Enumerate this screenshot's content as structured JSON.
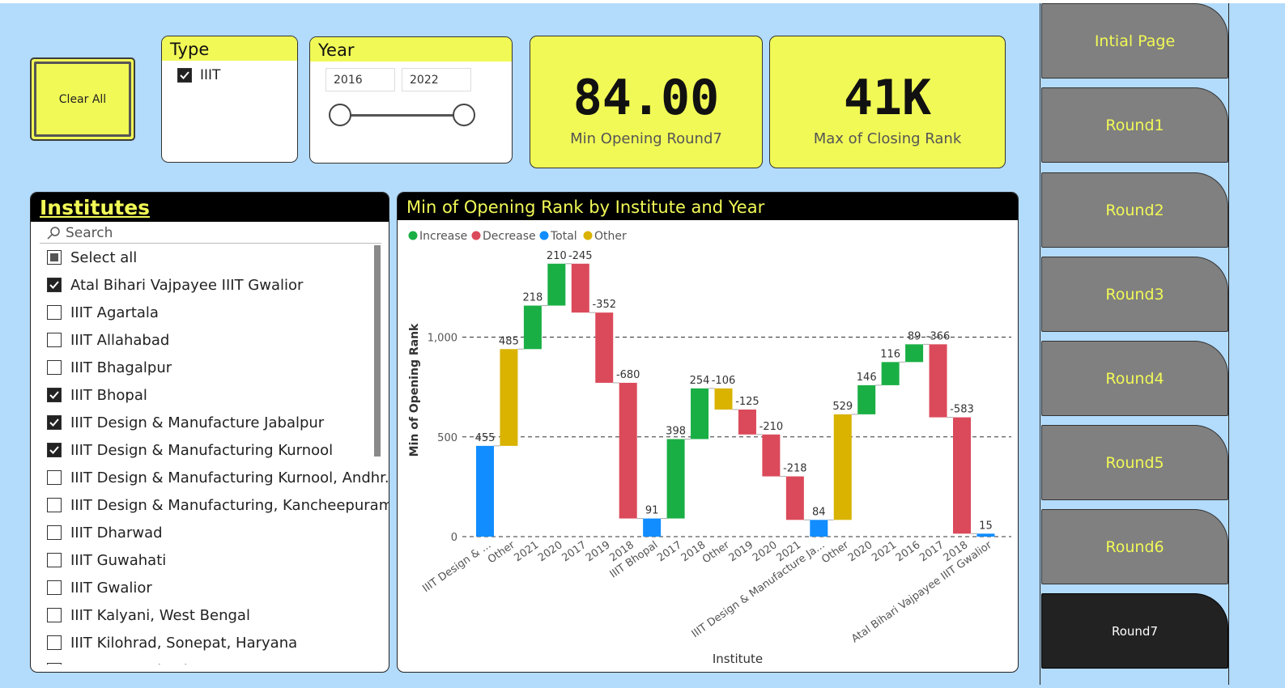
{
  "clear_button": {
    "label": "Clear All"
  },
  "type_slicer": {
    "title": "Type",
    "items": [
      {
        "label": "IIIT",
        "checked": true
      }
    ]
  },
  "year_slicer": {
    "title": "Year",
    "from": "2016",
    "to": "2022"
  },
  "kpis": [
    {
      "value": "84.00",
      "label": "Min Opening Round7"
    },
    {
      "value": "41K",
      "label": "Max of Closing Rank"
    }
  ],
  "institutes": {
    "title": "Institutes",
    "search_placeholder": "Search",
    "items": [
      {
        "label": "Select all",
        "state": "partial"
      },
      {
        "label": "Atal Bihari Vajpayee IIIT Gwalior",
        "state": "checked"
      },
      {
        "label": "IIIT Agartala",
        "state": "unchecked"
      },
      {
        "label": "IIIT Allahabad",
        "state": "unchecked"
      },
      {
        "label": "IIIT Bhagalpur",
        "state": "unchecked"
      },
      {
        "label": "IIIT Bhopal",
        "state": "checked"
      },
      {
        "label": "IIIT Design & Manufacture Jabalpur",
        "state": "checked"
      },
      {
        "label": "IIIT Design & Manufacturing Kurnool",
        "state": "checked"
      },
      {
        "label": "IIIT Design & Manufacturing Kurnool, Andhr...",
        "state": "unchecked"
      },
      {
        "label": "IIIT Design & Manufacturing, Kancheepuram",
        "state": "unchecked"
      },
      {
        "label": "IIIT Dharwad",
        "state": "unchecked"
      },
      {
        "label": "IIIT Guwahati",
        "state": "unchecked"
      },
      {
        "label": "IIIT Gwalior",
        "state": "unchecked"
      },
      {
        "label": "IIIT Kalyani, West Bengal",
        "state": "unchecked"
      },
      {
        "label": "IIIT Kilohrad, Sonepat, Haryana",
        "state": "unchecked"
      },
      {
        "label": "IIIT Kota, Rajasthan",
        "state": "unchecked"
      }
    ]
  },
  "nav": {
    "items": [
      {
        "label": "Intial Page",
        "active": false
      },
      {
        "label": "Round1",
        "active": false
      },
      {
        "label": "Round2",
        "active": false
      },
      {
        "label": "Round3",
        "active": false
      },
      {
        "label": "Round4",
        "active": false
      },
      {
        "label": "Round5",
        "active": false
      },
      {
        "label": "Round6",
        "active": false
      },
      {
        "label": "Round7",
        "active": true
      }
    ]
  },
  "colors": {
    "increase": "#1aaf45",
    "decrease": "#db4a5a",
    "total": "#118dff",
    "other": "#d9b300",
    "accent": "#f1f956"
  },
  "chart_data": {
    "type": "waterfall",
    "title": "Min of Opening Rank by Institute and Year",
    "xlabel": "Institute",
    "ylabel": "Min of Opening Rank",
    "ylim": [
      0,
      1000
    ],
    "yticks": [
      0,
      500,
      1000
    ],
    "ytick_labels": [
      "0",
      "500",
      "1,000"
    ],
    "grid": true,
    "legend": {
      "position": "top-left",
      "entries": [
        {
          "name": "Increase",
          "kind": "increase"
        },
        {
          "name": "Decrease",
          "kind": "decrease"
        },
        {
          "name": "Total",
          "kind": "total"
        },
        {
          "name": "Other",
          "kind": "other"
        }
      ]
    },
    "bars": [
      {
        "category": "IIIT Design & ...",
        "kind": "total",
        "start": 0,
        "end": 455,
        "label": "455"
      },
      {
        "category": "Other",
        "kind": "other",
        "start": 455,
        "end": 940,
        "label": "485"
      },
      {
        "category": "2021",
        "kind": "increase",
        "start": 940,
        "end": 1158,
        "label": "218"
      },
      {
        "category": "2020",
        "kind": "increase",
        "start": 1158,
        "end": 1368,
        "label": "210"
      },
      {
        "category": "2017",
        "kind": "decrease",
        "start": 1368,
        "end": 1123,
        "label": "-245"
      },
      {
        "category": "2019",
        "kind": "decrease",
        "start": 1123,
        "end": 771,
        "label": "-352"
      },
      {
        "category": "2018",
        "kind": "decrease",
        "start": 771,
        "end": 91,
        "label": "-680"
      },
      {
        "category": "IIIT Bhopal",
        "kind": "total",
        "start": 0,
        "end": 91,
        "label": "91"
      },
      {
        "category": "2017",
        "kind": "increase",
        "start": 91,
        "end": 489,
        "label": "398"
      },
      {
        "category": "2018",
        "kind": "increase",
        "start": 489,
        "end": 743,
        "label": "254"
      },
      {
        "category": "Other",
        "kind": "other",
        "start": 743,
        "end": 637,
        "label": "-106"
      },
      {
        "category": "2019",
        "kind": "decrease",
        "start": 637,
        "end": 512,
        "label": "-125"
      },
      {
        "category": "2020",
        "kind": "decrease",
        "start": 512,
        "end": 302,
        "label": "-210"
      },
      {
        "category": "2021",
        "kind": "decrease",
        "start": 302,
        "end": 84,
        "label": "-218"
      },
      {
        "category": "IIIT Design & Manufacture Ja...",
        "kind": "total",
        "start": 0,
        "end": 84,
        "label": "84"
      },
      {
        "category": "Other",
        "kind": "other",
        "start": 84,
        "end": 613,
        "label": "529"
      },
      {
        "category": "2020",
        "kind": "increase",
        "start": 613,
        "end": 759,
        "label": "146"
      },
      {
        "category": "2021",
        "kind": "increase",
        "start": 759,
        "end": 875,
        "label": "116"
      },
      {
        "category": "2016",
        "kind": "increase",
        "start": 875,
        "end": 964,
        "label": "89"
      },
      {
        "category": "2017",
        "kind": "decrease",
        "start": 964,
        "end": 598,
        "label": "-366"
      },
      {
        "category": "2018",
        "kind": "decrease",
        "start": 598,
        "end": 15,
        "label": "-583"
      },
      {
        "category": "Atal Bihari Vajpayee IIIT Gwalior",
        "kind": "total",
        "start": 0,
        "end": 15,
        "label": "15"
      }
    ]
  }
}
